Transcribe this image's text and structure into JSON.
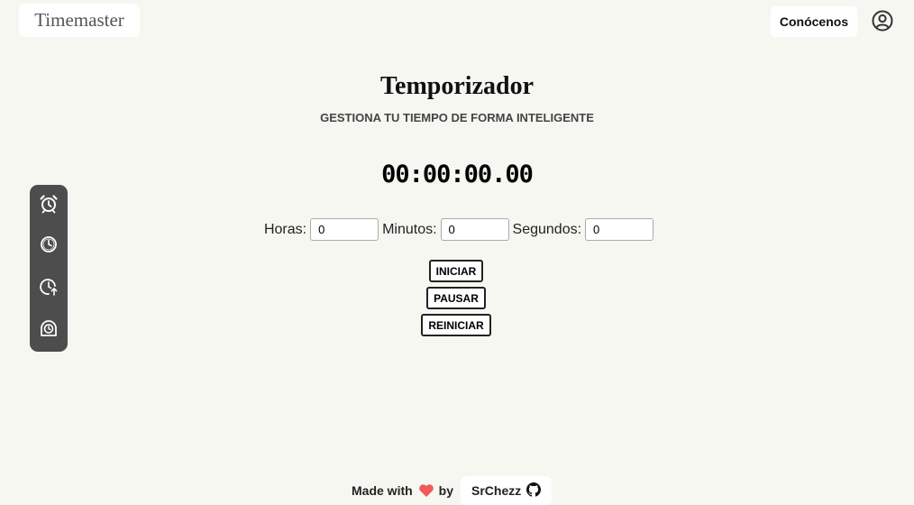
{
  "header": {
    "logo": "Timemaster",
    "about_label": "Conócenos"
  },
  "main": {
    "title": "Temporizador",
    "subtitle": "GESTIONA TU TIEMPO DE FORMA INTELIGENTE",
    "display": "00:00:00.00"
  },
  "inputs": {
    "hours_label": "Horas:",
    "hours_value": "0",
    "minutes_label": "Minutos:",
    "minutes_value": "0",
    "seconds_label": "Segundos:",
    "seconds_value": "0"
  },
  "buttons": {
    "start": "INICIAR",
    "pause": "PAUSAR",
    "reset": "REINICIAR"
  },
  "sidebar": {
    "items": [
      {
        "icon": "alarm-clock-icon"
      },
      {
        "icon": "clock-icon"
      },
      {
        "icon": "clock-arrow-up-icon"
      },
      {
        "icon": "stopwatch-icon"
      }
    ]
  },
  "footer": {
    "made_with": "Made with by",
    "by": "by",
    "author": "SrChezz"
  },
  "colors": {
    "background": "#f7f7f2",
    "sidebar": "#4d4d4d",
    "heart": "#f05a5a"
  }
}
